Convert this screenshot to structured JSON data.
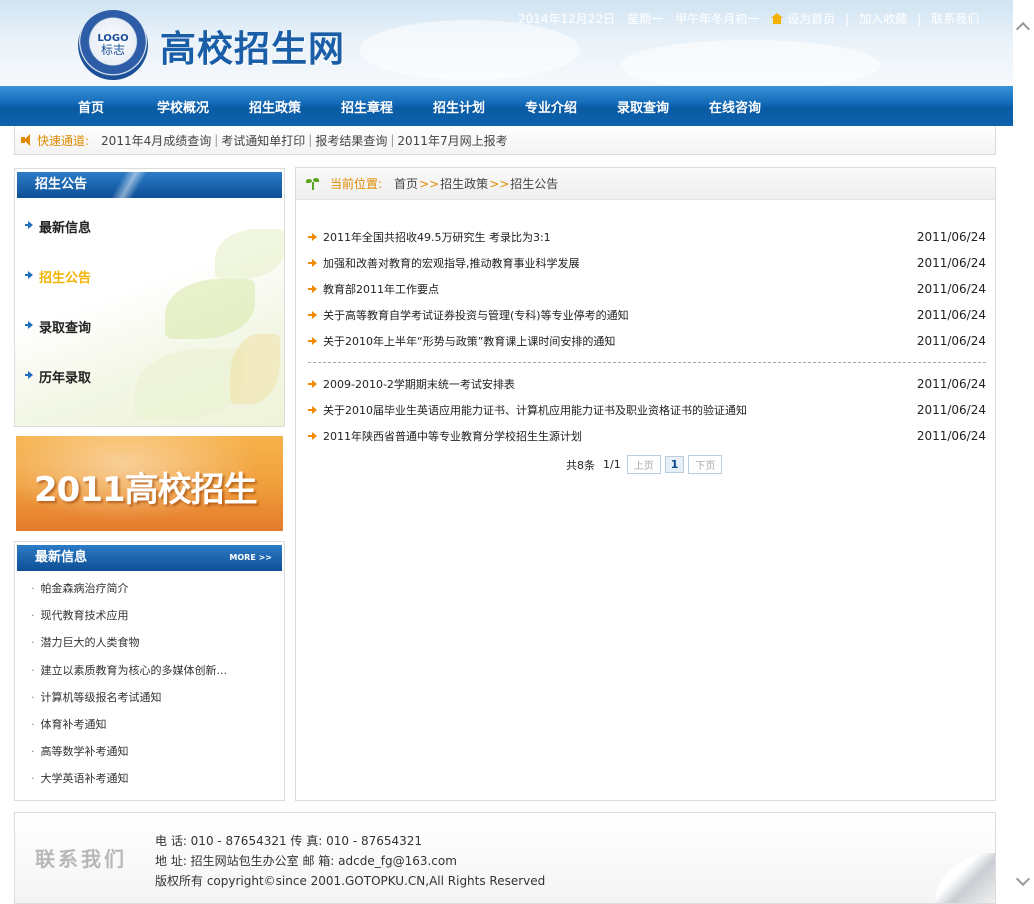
{
  "header": {
    "logo_line1": "LOGO",
    "logo_line2": "标志",
    "site_title": "高校招生网",
    "date": "2014年12月22日",
    "weekday": "星期一",
    "lunar": "甲午年冬月初一",
    "set_home": "设为首页",
    "add_fav": "加入收藏",
    "contact": "联系我们"
  },
  "nav": [
    "首页",
    "学校概况",
    "招生政策",
    "招生章程",
    "招生计划",
    "专业介绍",
    "录取查询",
    "在线咨询"
  ],
  "quick": {
    "label": "快速通道:",
    "links": [
      "2011年4月成绩查询",
      "考试通知单打印",
      "报考结果查询",
      "2011年7月网上报考"
    ]
  },
  "sidebar": {
    "title": "招生公告",
    "items": [
      {
        "label": "最新信息",
        "active": false
      },
      {
        "label": "招生公告",
        "active": true
      },
      {
        "label": "录取查询",
        "active": false
      },
      {
        "label": "历年录取",
        "active": false
      }
    ]
  },
  "banner": {
    "text": "2011高校招生"
  },
  "news": {
    "title": "最新信息",
    "more": "MORE >>",
    "items": [
      "帕金森病治疗简介",
      "现代教育技术应用",
      "潜力巨大的人类食物",
      "建立以素质教育为核心的多媒体创新...",
      "计算机等级报名考试通知",
      "体育补考通知",
      "高等数学补考通知",
      "大学英语补考通知"
    ]
  },
  "breadcrumb": {
    "label": "当前位置:",
    "items": [
      "首页",
      "招生政策",
      "招生公告"
    ],
    "sep": ">>"
  },
  "articles_group1": [
    {
      "title": "2011年全国共招收49.5万研究生 考录比为3:1",
      "date": "2011/06/24"
    },
    {
      "title": "加强和改善对教育的宏观指导,推动教育事业科学发展",
      "date": "2011/06/24"
    },
    {
      "title": "教育部2011年工作要点",
      "date": "2011/06/24"
    },
    {
      "title": "关于高等教育自学考试证券投资与管理(专科)等专业停考的通知",
      "date": "2011/06/24"
    },
    {
      "title": "关于2010年上半年“形势与政策”教育课上课时间安排的通知",
      "date": "2011/06/24"
    }
  ],
  "articles_group2": [
    {
      "title": "2009-2010-2学期期末统一考试安排表",
      "date": "2011/06/24"
    },
    {
      "title": "关于2010届毕业生英语应用能力证书、计算机应用能力证书及职业资格证书的验证通知",
      "date": "2011/06/24"
    },
    {
      "title": "2011年陕西省普通中等专业教育分学校招生生源计划",
      "date": "2011/06/24"
    }
  ],
  "pager": {
    "total": "共8条",
    "page": "1/1",
    "prev": "上页",
    "current": "1",
    "next": "下页"
  },
  "footer": {
    "watermark": "联系我们",
    "line1": "电  话: 010 - 87654321 传  真: 010 - 87654321",
    "line2": "地  址: 招生网站包生办公室 邮  箱: adcde_fg@163.com",
    "line3": "版权所有  copyright©since 2001.GOTOPKU.CN,All Rights Reserved"
  },
  "colors": {
    "nav_blue": "#0d63ae",
    "accent_orange": "#e08a00",
    "active_yellow": "#f2b200"
  }
}
